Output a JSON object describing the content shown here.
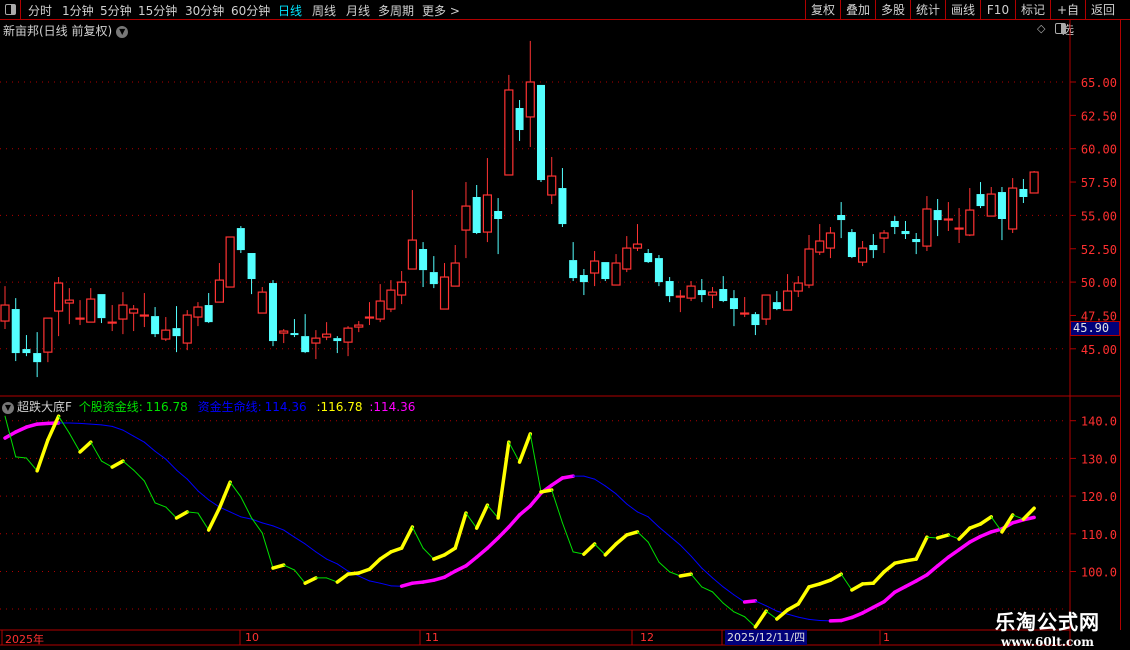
{
  "toolbar": {
    "periods": [
      "分时",
      "1分钟",
      "5分钟",
      "15分钟",
      "30分钟",
      "60分钟",
      "日线",
      "周线",
      "月线",
      "多周期",
      "更多 >"
    ],
    "active_period": "日线",
    "buttons": [
      "复权",
      "叠加",
      "多股",
      "统计",
      "画线",
      "F10",
      "标记",
      "+自选",
      "返回"
    ]
  },
  "stock": {
    "title": "新亩邦(日线 前复权)"
  },
  "price_axis": {
    "ticks": [
      "65.00",
      "62.50",
      "60.00",
      "57.50",
      "55.00",
      "52.50",
      "50.00",
      "47.50",
      "45.00"
    ],
    "current": "45.90"
  },
  "indicator": {
    "name": "超跌大底F",
    "line1_label": "个股资金线:",
    "line1_value": "116.78",
    "line2_label": "资金生命线:",
    "line2_value": "114.36",
    "extra1": ":116.78",
    "extra2": ":114.36",
    "ticks": [
      "140.0",
      "130.0",
      "120.0",
      "110.0",
      "100.0"
    ]
  },
  "date_axis": {
    "labels": [
      "2025年",
      "10",
      "11",
      "12",
      "1"
    ],
    "cursor": "2025/12/11/四"
  },
  "watermark": {
    "name": "乐淘公式网",
    "url": "www.60lt.com"
  },
  "colors": {
    "up": "#ff3333",
    "down": "#54ffff",
    "line1": "#00e000",
    "line1_rise": "#ffff00",
    "line2": "#0000ff",
    "line2_rise": "#ff00ff",
    "grid": "#b00000"
  },
  "chart_data": {
    "type": "candlestick",
    "ylim": [
      42,
      70
    ],
    "ohlc": [
      [
        47.08,
        49.7,
        46.48,
        48.28
      ],
      [
        47.98,
        48.8,
        44.08,
        44.68
      ],
      [
        44.98,
        46.03,
        44.45,
        44.68
      ],
      [
        44.68,
        46.25,
        42.88,
        44.0
      ],
      [
        44.75,
        47.3,
        44.0,
        47.3
      ],
      [
        47.83,
        50.38,
        45.95,
        49.93
      ],
      [
        48.43,
        49.55,
        46.85,
        48.65
      ],
      [
        47.3,
        48.65,
        46.78,
        47.3
      ],
      [
        47.0,
        49.55,
        47.0,
        48.73
      ],
      [
        49.1,
        49.1,
        46.93,
        47.3
      ],
      [
        47.0,
        48.28,
        46.33,
        47.0
      ],
      [
        47.23,
        49.25,
        46.1,
        48.28
      ],
      [
        47.68,
        48.28,
        46.33,
        47.98
      ],
      [
        47.53,
        49.18,
        46.63,
        47.53
      ],
      [
        47.45,
        48.13,
        45.88,
        46.1
      ],
      [
        45.73,
        47.38,
        45.58,
        46.4
      ],
      [
        46.55,
        48.2,
        44.75,
        45.95
      ],
      [
        45.43,
        47.9,
        44.9,
        47.53
      ],
      [
        47.38,
        48.5,
        46.7,
        48.13
      ],
      [
        48.28,
        49.18,
        46.93,
        47.0
      ],
      [
        48.5,
        51.43,
        48.5,
        50.15
      ],
      [
        49.63,
        53.38,
        49.63,
        53.38
      ],
      [
        54.05,
        54.2,
        52.18,
        52.4
      ],
      [
        52.18,
        52.18,
        49.1,
        50.23
      ],
      [
        47.68,
        49.63,
        47.68,
        49.25
      ],
      [
        49.93,
        50.15,
        45.2,
        45.58
      ],
      [
        46.18,
        46.48,
        45.43,
        46.33
      ],
      [
        46.18,
        47.23,
        45.88,
        46.03
      ],
      [
        45.95,
        47.6,
        44.68,
        44.75
      ],
      [
        45.43,
        46.4,
        44.23,
        45.8
      ],
      [
        45.88,
        47.0,
        45.65,
        46.1
      ],
      [
        45.8,
        45.95,
        44.68,
        45.58
      ],
      [
        45.5,
        46.7,
        44.45,
        46.55
      ],
      [
        46.63,
        47.08,
        46.25,
        46.78
      ],
      [
        47.38,
        48.5,
        46.78,
        47.38
      ],
      [
        47.23,
        49.85,
        47.0,
        48.58
      ],
      [
        47.98,
        50.15,
        47.75,
        49.4
      ],
      [
        49.03,
        50.83,
        48.35,
        50.0
      ],
      [
        50.98,
        56.9,
        50.98,
        53.15
      ],
      [
        52.48,
        53.0,
        49.63,
        50.9
      ],
      [
        50.75,
        51.95,
        49.55,
        49.85
      ],
      [
        47.98,
        51.43,
        47.98,
        50.38
      ],
      [
        49.7,
        52.78,
        49.7,
        51.43
      ],
      [
        53.9,
        57.5,
        51.8,
        55.7
      ],
      [
        56.38,
        57.28,
        53.6,
        53.68
      ],
      [
        53.75,
        59.3,
        53.0,
        56.53
      ],
      [
        55.33,
        56.3,
        52.1,
        54.73
      ],
      [
        58.03,
        65.53,
        58.03,
        64.4
      ],
      [
        63.05,
        63.65,
        60.58,
        61.4
      ],
      [
        62.38,
        68.08,
        60.13,
        65.0
      ],
      [
        64.78,
        64.78,
        57.5,
        57.65
      ],
      [
        56.53,
        59.38,
        55.85,
        57.95
      ],
      [
        57.05,
        58.55,
        54.13,
        54.35
      ],
      [
        51.65,
        53.0,
        50.08,
        50.3
      ],
      [
        50.53,
        50.98,
        49.03,
        50.0
      ],
      [
        50.68,
        52.33,
        49.7,
        51.58
      ],
      [
        51.5,
        51.5,
        50.08,
        50.23
      ],
      [
        49.78,
        52.1,
        49.78,
        51.43
      ],
      [
        50.98,
        53.45,
        50.75,
        52.55
      ],
      [
        52.55,
        54.35,
        52.33,
        52.85
      ],
      [
        52.18,
        52.48,
        51.43,
        51.5
      ],
      [
        51.8,
        52.03,
        49.7,
        50.0
      ],
      [
        50.08,
        50.38,
        48.5,
        48.95
      ],
      [
        48.95,
        49.4,
        47.75,
        48.95
      ],
      [
        48.8,
        50.08,
        48.58,
        49.7
      ],
      [
        49.4,
        50.23,
        48.5,
        49.03
      ],
      [
        49.03,
        49.63,
        48.05,
        49.25
      ],
      [
        49.48,
        50.45,
        48.5,
        48.58
      ],
      [
        48.8,
        49.4,
        46.7,
        47.98
      ],
      [
        47.68,
        48.88,
        47.38,
        47.68
      ],
      [
        47.6,
        47.75,
        46.03,
        46.78
      ],
      [
        47.23,
        49.03,
        46.78,
        49.03
      ],
      [
        48.5,
        49.33,
        47.9,
        47.98
      ],
      [
        47.9,
        50.6,
        47.9,
        49.33
      ],
      [
        49.33,
        50.45,
        48.88,
        49.93
      ],
      [
        49.78,
        53.53,
        49.55,
        52.48
      ],
      [
        52.25,
        54.35,
        52.03,
        53.08
      ],
      [
        52.55,
        54.13,
        51.8,
        53.68
      ],
      [
        55.03,
        56.0,
        53.3,
        54.65
      ],
      [
        53.75,
        53.98,
        51.8,
        51.88
      ],
      [
        51.5,
        53.08,
        51.2,
        52.55
      ],
      [
        52.78,
        53.6,
        51.8,
        52.4
      ],
      [
        53.3,
        53.9,
        52.18,
        53.68
      ],
      [
        54.58,
        54.95,
        53.6,
        54.13
      ],
      [
        53.83,
        54.58,
        53.23,
        53.6
      ],
      [
        53.23,
        53.68,
        52.1,
        53.0
      ],
      [
        52.7,
        56.45,
        52.33,
        55.48
      ],
      [
        55.4,
        56.23,
        53.45,
        54.65
      ],
      [
        54.73,
        56.0,
        53.83,
        54.73
      ],
      [
        54.05,
        55.55,
        52.93,
        54.05
      ],
      [
        53.53,
        57.05,
        53.45,
        55.4
      ],
      [
        56.6,
        57.5,
        55.55,
        55.7
      ],
      [
        54.95,
        57.13,
        54.95,
        56.6
      ],
      [
        56.75,
        57.13,
        53.15,
        54.73
      ],
      [
        53.98,
        57.8,
        53.68,
        57.05
      ],
      [
        56.98,
        57.73,
        55.93,
        56.38
      ],
      [
        56.68,
        58.33,
        56.68,
        58.25
      ]
    ],
    "indicator_ylim": [
      84,
      144
    ],
    "series": [
      {
        "name": "个股资金线",
        "values": [
          141.2,
          130.4,
          130.1,
          126.7,
          134.9,
          141.2,
          136.7,
          131.7,
          134.3,
          129.3,
          127.7,
          129.3,
          126.9,
          124.0,
          118.2,
          117.1,
          114.2,
          115.8,
          115.5,
          111.0,
          116.8,
          123.7,
          119.8,
          114.2,
          110.2,
          100.9,
          101.7,
          100.4,
          96.9,
          98.3,
          98.3,
          97.2,
          99.3,
          99.6,
          100.6,
          103.3,
          105.2,
          106.2,
          111.8,
          106.2,
          103.3,
          104.4,
          106.2,
          115.5,
          111.5,
          117.6,
          114.2,
          134.3,
          129.0,
          136.5,
          121.1,
          121.6,
          112.9,
          105.2,
          104.6,
          107.3,
          104.4,
          107.3,
          109.7,
          110.5,
          107.8,
          102.5,
          99.9,
          98.8,
          99.3,
          95.9,
          94.6,
          91.6,
          89.3,
          88.0,
          85.3,
          89.5,
          87.4,
          89.8,
          91.4,
          95.9,
          96.7,
          97.7,
          99.3,
          95.1,
          96.7,
          96.9,
          99.9,
          102.2,
          102.8,
          103.3,
          109.1,
          108.9,
          109.7,
          108.6,
          111.5,
          112.6,
          114.5,
          110.5,
          115.0,
          113.9,
          116.78
        ]
      },
      {
        "name": "资金生命线",
        "values": [
          135.4,
          137.0,
          138.3,
          139.1,
          139.3,
          139.4,
          139.4,
          139.3,
          139.1,
          138.9,
          138.5,
          137.5,
          135.9,
          134.3,
          131.9,
          129.8,
          126.9,
          124.5,
          121.4,
          119.0,
          117.1,
          115.8,
          114.5,
          113.9,
          112.9,
          112.1,
          111.0,
          109.1,
          107.3,
          105.2,
          103.3,
          102.0,
          100.1,
          98.8,
          97.5,
          96.9,
          96.2,
          96.1,
          96.9,
          97.2,
          97.7,
          98.5,
          100.1,
          101.5,
          103.8,
          106.2,
          108.9,
          111.8,
          115.0,
          117.4,
          120.8,
          122.9,
          124.8,
          125.3,
          125.3,
          124.5,
          122.7,
          120.6,
          117.9,
          115.8,
          114.5,
          111.8,
          109.4,
          107.0,
          104.1,
          100.9,
          98.3,
          95.9,
          93.8,
          91.9,
          92.2,
          90.9,
          89.5,
          88.7,
          87.9,
          87.3,
          87.0,
          86.9,
          87.0,
          87.8,
          89.0,
          90.5,
          92.0,
          94.5,
          96.0,
          97.5,
          99.1,
          101.5,
          103.8,
          105.8,
          107.8,
          109.3,
          110.5,
          111.3,
          112.9,
          113.7,
          114.36
        ]
      }
    ]
  }
}
